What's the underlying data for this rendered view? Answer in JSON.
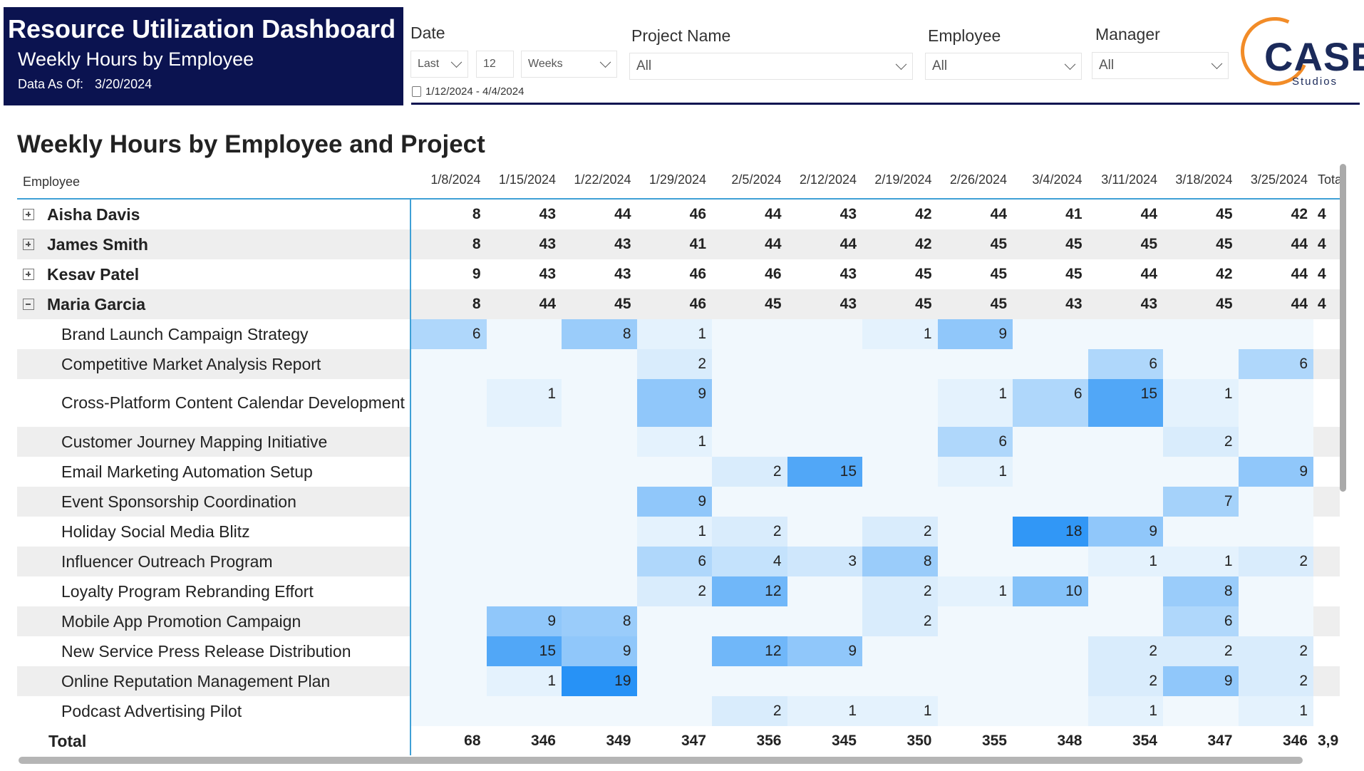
{
  "header": {
    "title": "Resource Utilization Dashboard",
    "subtitle": "Weekly Hours by Employee",
    "data_as_of_label": "Data As Of:",
    "data_as_of": "3/20/2024"
  },
  "filters": {
    "date": {
      "label": "Date",
      "mode": "Last",
      "count": "12",
      "unit": "Weeks",
      "range": "1/12/2024 - 4/4/2024"
    },
    "project": {
      "label": "Project Name",
      "value": "All"
    },
    "employee": {
      "label": "Employee",
      "value": "All"
    },
    "manager": {
      "label": "Manager",
      "value": "All"
    }
  },
  "logo": {
    "text": "CASE",
    "sub": "Studios",
    "colors": {
      "arc": "#f28c28",
      "text": "#1b2a5a"
    }
  },
  "matrix": {
    "title": "Weekly Hours by Employee and Project",
    "row_header": "Employee",
    "columns": [
      "1/8/2024",
      "1/15/2024",
      "1/22/2024",
      "1/29/2024",
      "2/5/2024",
      "2/12/2024",
      "2/19/2024",
      "2/26/2024",
      "3/4/2024",
      "3/11/2024",
      "3/18/2024",
      "3/25/2024"
    ],
    "total_header": "Total",
    "employees": [
      {
        "name": "Aisha Davis",
        "expanded": false,
        "values": [
          8,
          43,
          44,
          46,
          44,
          43,
          42,
          44,
          41,
          44,
          45,
          42
        ],
        "total": "4"
      },
      {
        "name": "James Smith",
        "expanded": false,
        "values": [
          8,
          43,
          43,
          41,
          44,
          44,
          42,
          45,
          45,
          45,
          45,
          44
        ],
        "total": "4"
      },
      {
        "name": "Kesav Patel",
        "expanded": false,
        "values": [
          9,
          43,
          43,
          46,
          46,
          43,
          45,
          45,
          45,
          44,
          42,
          44
        ],
        "total": "4"
      },
      {
        "name": "Maria Garcia",
        "expanded": true,
        "values": [
          8,
          44,
          45,
          46,
          45,
          43,
          45,
          45,
          43,
          43,
          45,
          44
        ],
        "total": "4",
        "projects": [
          {
            "name": "Brand Launch Campaign Strategy",
            "values": [
              6,
              null,
              8,
              1,
              null,
              null,
              1,
              9,
              null,
              null,
              null,
              null
            ]
          },
          {
            "name": "Competitive Market Analysis Report",
            "values": [
              null,
              null,
              null,
              2,
              null,
              null,
              null,
              null,
              null,
              6,
              null,
              6
            ]
          },
          {
            "name": "Cross-Platform Content Calendar Development",
            "values": [
              null,
              1,
              null,
              9,
              null,
              null,
              null,
              1,
              6,
              15,
              1,
              null
            ]
          },
          {
            "name": "Customer Journey Mapping Initiative",
            "values": [
              null,
              null,
              null,
              1,
              null,
              null,
              null,
              6,
              null,
              null,
              2,
              null
            ]
          },
          {
            "name": "Email Marketing Automation Setup",
            "values": [
              null,
              null,
              null,
              null,
              2,
              15,
              null,
              1,
              null,
              null,
              null,
              9
            ]
          },
          {
            "name": "Event Sponsorship Coordination",
            "values": [
              null,
              null,
              null,
              9,
              null,
              null,
              null,
              null,
              null,
              null,
              7,
              null
            ]
          },
          {
            "name": "Holiday Social Media Blitz",
            "values": [
              null,
              null,
              null,
              1,
              2,
              null,
              2,
              null,
              18,
              9,
              null,
              null
            ]
          },
          {
            "name": "Influencer Outreach Program",
            "values": [
              null,
              null,
              null,
              6,
              4,
              3,
              8,
              null,
              null,
              1,
              1,
              2
            ]
          },
          {
            "name": "Loyalty Program Rebranding Effort",
            "values": [
              null,
              null,
              null,
              2,
              12,
              null,
              2,
              1,
              10,
              null,
              8,
              null
            ]
          },
          {
            "name": "Mobile App Promotion Campaign",
            "values": [
              null,
              9,
              8,
              null,
              null,
              null,
              2,
              null,
              null,
              null,
              6,
              null
            ]
          },
          {
            "name": "New Service Press Release Distribution",
            "values": [
              null,
              15,
              9,
              null,
              12,
              9,
              null,
              null,
              null,
              2,
              2,
              2
            ]
          },
          {
            "name": "Online Reputation Management Plan",
            "values": [
              null,
              1,
              19,
              null,
              null,
              null,
              null,
              null,
              null,
              2,
              9,
              2
            ]
          },
          {
            "name": "Podcast Advertising Pilot",
            "values": [
              null,
              null,
              null,
              null,
              2,
              1,
              1,
              null,
              null,
              1,
              null,
              1
            ]
          }
        ]
      }
    ],
    "total_label": "Total",
    "totals": [
      68,
      346,
      349,
      347,
      356,
      345,
      350,
      355,
      348,
      354,
      347,
      346
    ],
    "grand_total": "3,9",
    "heat_colors": {
      "low": "#eef7fd",
      "high": "#2792f6"
    }
  }
}
